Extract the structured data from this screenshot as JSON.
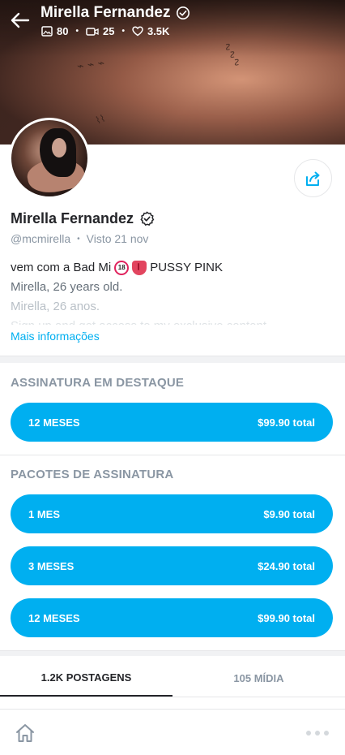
{
  "header": {
    "title": "Mirella Fernandez",
    "stats": {
      "photos": "80",
      "videos": "25",
      "likes": "3.5K"
    }
  },
  "profile": {
    "name": "Mirella Fernandez",
    "handle": "@mcmirella",
    "last_seen": "Visto  21 nov",
    "bio_line1_start": "vem com a Bad Mi",
    "bio_line1_end": "PUSSY PINK",
    "bio_line2": "Mirella, 26 years old.",
    "bio_line3": "Mirella, 26 anos.",
    "bio_line4": "Sign up and get access to my exclusive content",
    "more_info": "Mais informações"
  },
  "featured": {
    "title": "ASSINATURA EM DESTAQUE",
    "button": {
      "period": "12 MESES",
      "price": "$99.90 total"
    }
  },
  "bundles": {
    "title": "PACOTES DE ASSINATURA",
    "items": [
      {
        "period": "1 MES",
        "price": "$9.90 total"
      },
      {
        "period": "3 MESES",
        "price": "$24.90 total"
      },
      {
        "period": "12 MESES",
        "price": "$99.90 total"
      }
    ]
  },
  "tabs": [
    {
      "label": "1.2K POSTAGENS"
    },
    {
      "label": "105 MÍDIA"
    }
  ],
  "colors": {
    "accent": "#00aff0",
    "text_primary": "#242529",
    "text_secondary": "#8a96a3"
  }
}
